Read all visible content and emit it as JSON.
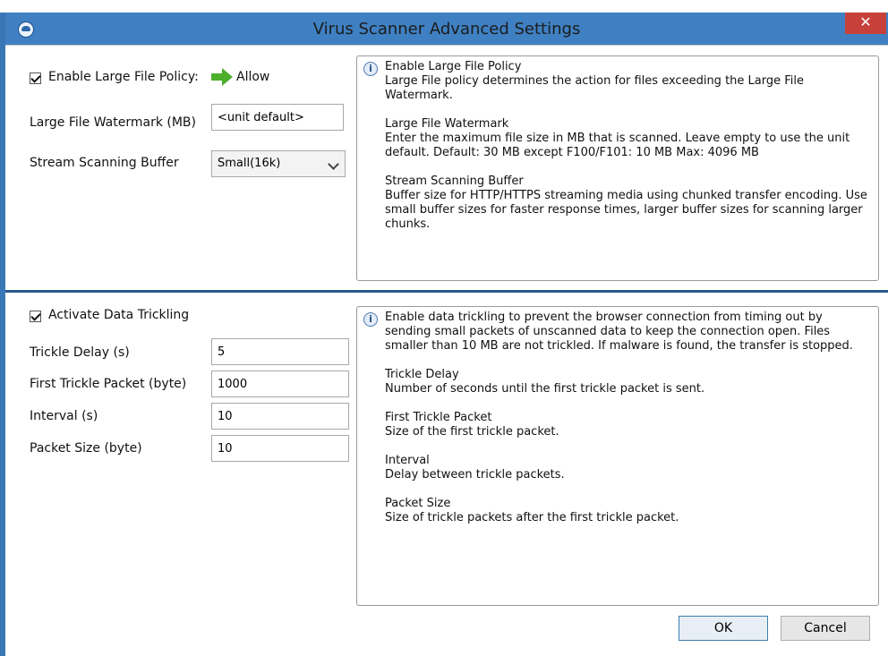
{
  "window": {
    "title": "Virus Scanner Advanced Settings",
    "close_label": "✕"
  },
  "large_file": {
    "enable_label": "Enable Large File Policy:",
    "enabled": true,
    "action_label": "Allow",
    "watermark_label": "Large File Watermark (MB)",
    "watermark_value": "<unit default>",
    "stream_buffer_label": "Stream Scanning Buffer",
    "stream_buffer_value": "Small(16k)",
    "info": {
      "heading1": "Enable Large File Policy",
      "text1": "Large File policy determines the action for files exceeding the Large File Watermark.",
      "heading2": "Large File Watermark",
      "text2": "Enter the maximum file size in MB that is scanned. Leave empty to use the unit default. Default: 30 MB except F100/F101: 10 MB Max: 4096 MB",
      "heading3": "Stream Scanning Buffer",
      "text3": "Buffer size for HTTP/HTTPS streaming media using chunked transfer encoding. Use small buffer sizes for faster response times, larger buffer sizes for scanning larger chunks."
    }
  },
  "trickling": {
    "activate_label": "Activate Data Trickling",
    "enabled": true,
    "delay_label": "Trickle Delay (s)",
    "delay_value": "5",
    "first_packet_label": "First Trickle Packet (byte)",
    "first_packet_value": "1000",
    "interval_label": "Interval (s)",
    "interval_value": "10",
    "packet_size_label": "Packet Size (byte)",
    "packet_size_value": "10",
    "info": {
      "intro": "Enable data trickling to prevent the browser connection from timing out by sending small packets of unscanned data to keep the connection open. Files smaller than 10 MB are not trickled. If malware is found, the transfer is stopped.",
      "heading1": "Trickle Delay",
      "text1": "Number of seconds until the first trickle packet is sent.",
      "heading2": "First Trickle Packet",
      "text2": "Size of the first trickle packet.",
      "heading3": "Interval",
      "text3": "Delay between trickle packets.",
      "heading4": "Packet Size",
      "text4": "Size of trickle packets after the first trickle packet."
    }
  },
  "buttons": {
    "ok_label": "OK",
    "cancel_label": "Cancel"
  },
  "colors": {
    "titlebar": "#3f80c2",
    "close": "#c7413a",
    "divider": "#2a5a8f",
    "allow_arrow": "#4caf2c"
  }
}
